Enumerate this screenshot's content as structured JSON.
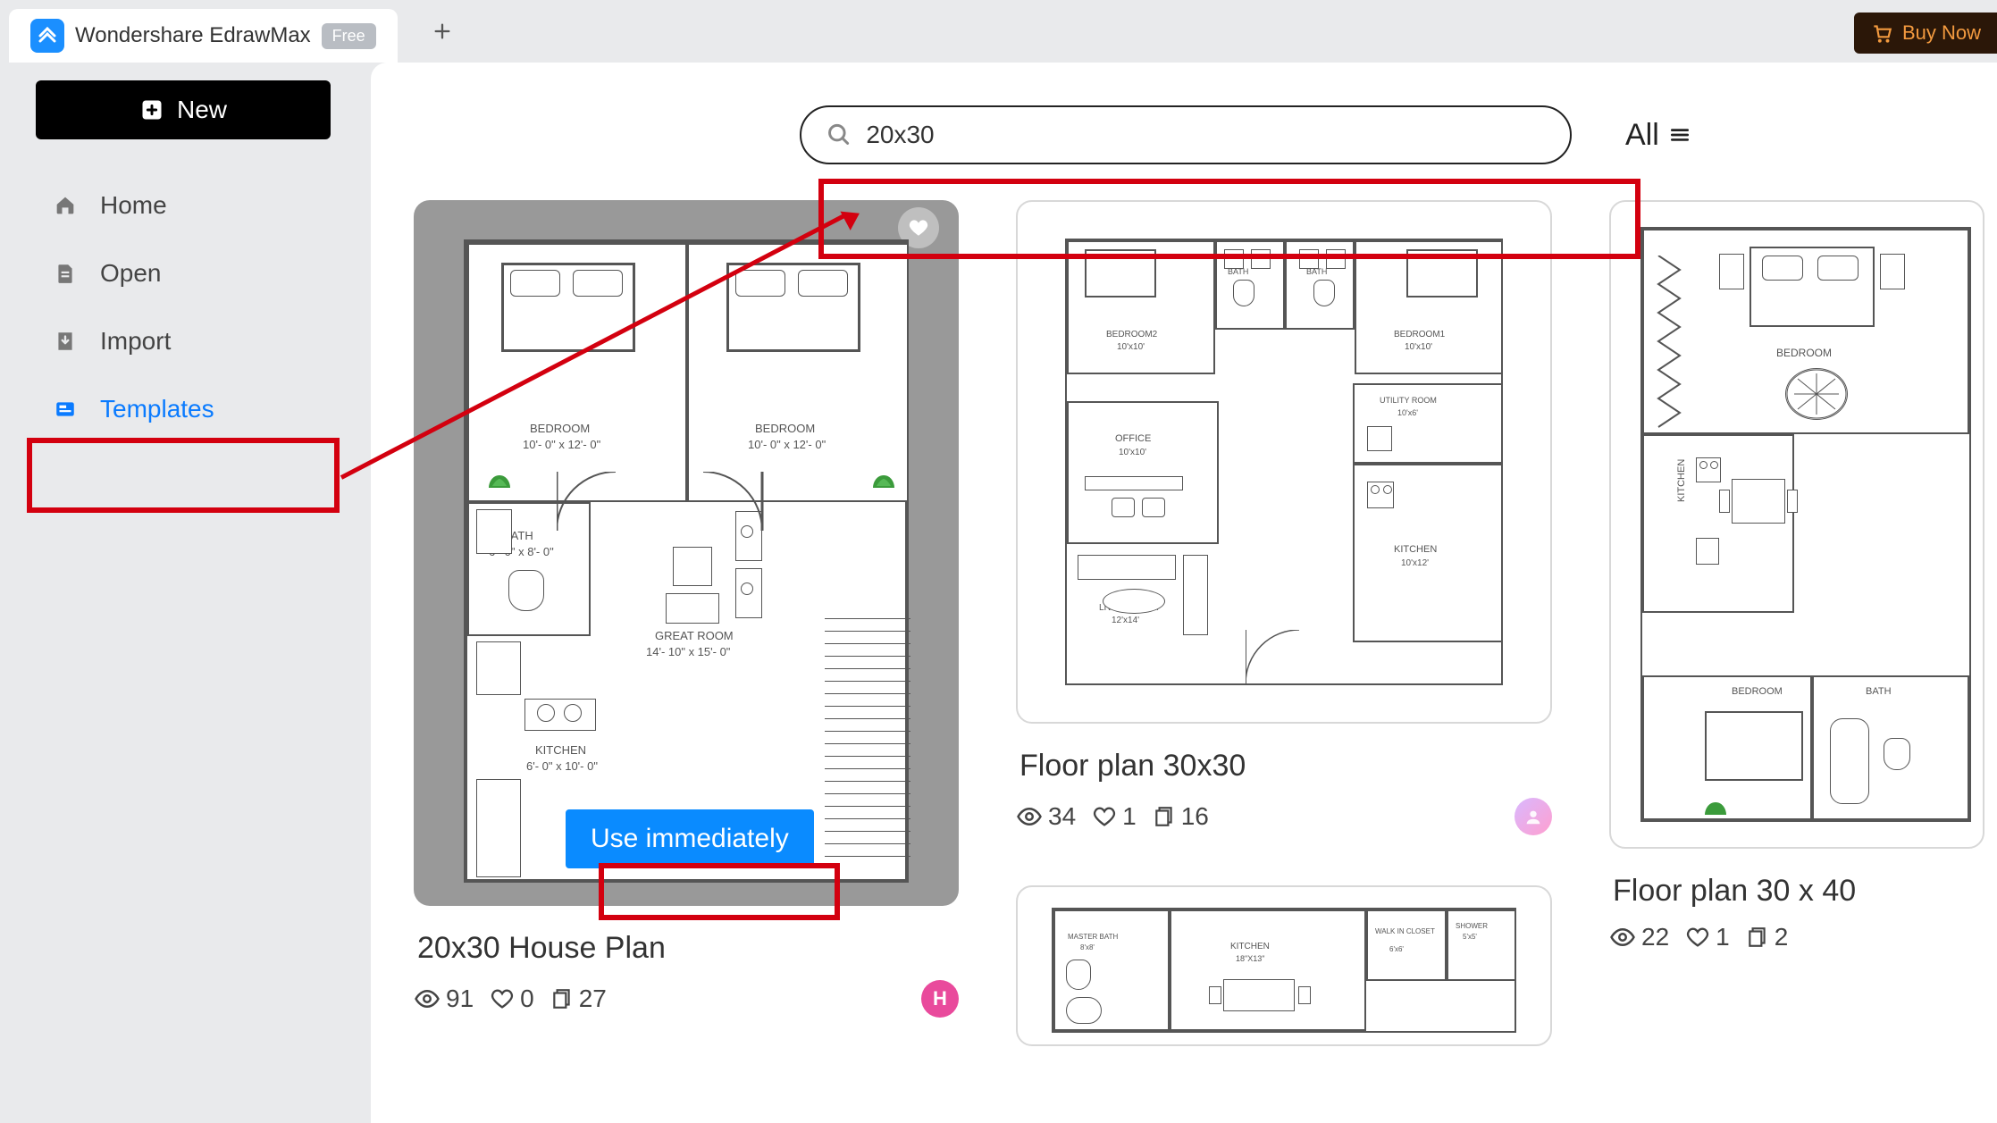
{
  "titlebar": {
    "app_title": "Wondershare EdrawMax",
    "badge": "Free",
    "buy_now": "Buy Now"
  },
  "sidebar": {
    "new_label": "New",
    "items": [
      {
        "label": "Home"
      },
      {
        "label": "Open"
      },
      {
        "label": "Import"
      },
      {
        "label": "Templates"
      }
    ]
  },
  "search": {
    "value": "20x30",
    "all_label": "All"
  },
  "cards": [
    {
      "title": "20x30 House Plan",
      "views": "91",
      "likes": "0",
      "copies": "27",
      "use_label": "Use immediately",
      "avatar_letter": "H",
      "plan": {
        "bedroom_label": "BEDROOM",
        "bedroom_dims": "10'- 0\" x 12'- 0\"",
        "bath_label": "BATH",
        "bath_dims": "6'- 0\" x 8'- 0\"",
        "great_room_label": "GREAT ROOM",
        "great_room_dims": "14'- 10\" x 15'- 0\"",
        "kitchen_label": "KITCHEN",
        "kitchen_dims": "6'- 0\" x 10'- 0\""
      }
    },
    {
      "title": "Floor plan 30x30",
      "views": "34",
      "likes": "1",
      "copies": "16",
      "plan": {
        "bed2_label": "BEDROOM2",
        "bed2_dims": "10'x10'",
        "bed1_label": "BEDROOM1",
        "bed1_dims": "10'x10'",
        "bath_label": "BATH",
        "office_label": "OFFICE",
        "office_dims": "10'x10'",
        "utility_label": "UTILITY ROOM",
        "utility_dims": "10'x6'",
        "kitchen_label": "KITCHEN",
        "kitchen_dims": "10'x12'",
        "living_label": "LIVING ROOM",
        "living_dims": "12'x14'"
      }
    },
    {
      "title": "Floor plan 30 x 40",
      "views": "22",
      "likes": "1",
      "copies": "2",
      "plan": {
        "bedroom_label": "BEDROOM",
        "kitchen_label": "KITCHEN",
        "bath_label": "BATH"
      }
    },
    {
      "plan": {
        "kitchen_label": "KITCHEN",
        "kitchen_dims": "18\"X13\"",
        "master_bath_label": "MASTER BATH",
        "master_bath_dims": "8'x8'",
        "walkin_label": "WALK IN CLOSET",
        "walkin_dims": "6'x6'",
        "shower_label": "SHOWER",
        "shower_dims": "5'x5'"
      }
    }
  ]
}
